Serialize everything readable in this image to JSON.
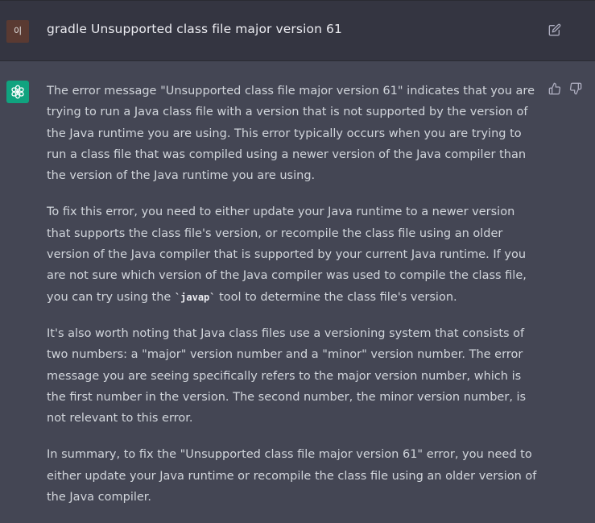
{
  "user_message": {
    "avatar_text": "이",
    "text": "gradle Unsupported class file major version 61"
  },
  "assistant_message": {
    "p1": "The error message \"Unsupported class file major version 61\" indicates that you are trying to run a Java class file with a version that is not supported by the version of the Java runtime you are using. This error typically occurs when you are trying to run a class file that was compiled using a newer version of the Java compiler than the version of the Java runtime you are using.",
    "p2_before": "To fix this error, you need to either update your Java runtime to a newer version that supports the class file's version, or recompile the class file using an older version of the Java compiler that is supported by your current Java runtime. If you are not sure which version of the Java compiler was used to compile the class file, you can try using the ",
    "p2_code": "`javap`",
    "p2_after": " tool to determine the class file's version.",
    "p3": "It's also worth noting that Java class files use a versioning system that consists of two numbers: a \"major\" version number and a \"minor\" version number. The error message you are seeing specifically refers to the major version number, which is the first number in the version. The second number, the minor version number, is not relevant to this error.",
    "p4": "In summary, to fix the \"Unsupported class file major version 61\" error, you need to either update your Java runtime or recompile the class file using an older version of the Java compiler."
  },
  "icons": {
    "user_edit": "edit-icon",
    "assistant_logo": "openai-logo-icon",
    "feedback_up": "thumbs-up-icon",
    "feedback_down": "thumbs-down-icon"
  },
  "colors": {
    "user_row_bg": "#343541",
    "assistant_row_bg": "#444654",
    "assistant_avatar_bg": "#10a37f",
    "user_avatar_bg": "#5a3a32",
    "text": "#d1d5db"
  }
}
